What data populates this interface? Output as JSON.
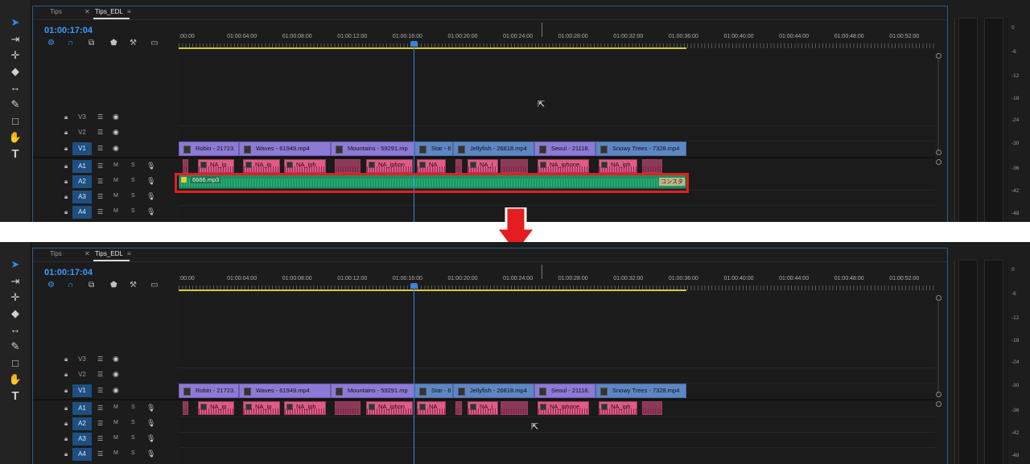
{
  "tabs": [
    {
      "label": "Tips"
    },
    {
      "label": "Tips_EDL"
    }
  ],
  "timecode": "01:00:17:04",
  "ruler_labels": ":00:00|01:00:04:00|01:00:08:00|01:00:12:00|01:00:16:00|01:00:20:00|01:00:24:00|01:00:28:00|01:00:32:00|01:00:36:00|01:00:40:00|01:00:44:00|01:00:48:00|01:00:52:00",
  "tracks": {
    "video": [
      "V3",
      "V2",
      "V1"
    ],
    "audio": [
      "A1",
      "A2",
      "A3",
      "A4"
    ],
    "mute_label": "M",
    "solo_label": "S"
  },
  "video_clips": [
    "Robin - 21723.",
    "Waves - 61949.mp4",
    "Mountains - 59291.mp",
    "Star - 6",
    "Jellyfish - 26818.mp4",
    "Seoul - 21118.",
    "Snowy Trees - 7328.mp4"
  ],
  "audio_clips": [
    "NA_ip",
    "NA_ip",
    "NA_iph",
    "NA_iphon",
    "NA",
    "NA_i",
    "NA_iphone.",
    "NA_iph"
  ],
  "mp3_clip": {
    "name": "6666.mp3",
    "tag": "コンスタ"
  },
  "meter_ticks": [
    "0",
    "-6",
    "-12",
    "-18",
    "-24",
    "-30",
    "-36",
    "-42",
    "-48"
  ],
  "colors": {
    "accent": "#3d9aff",
    "video_clip": "#8c7ad6",
    "audio_clip": "#e05b87",
    "music_clip": "#1f8f62",
    "highlight": "#e41e1e"
  }
}
